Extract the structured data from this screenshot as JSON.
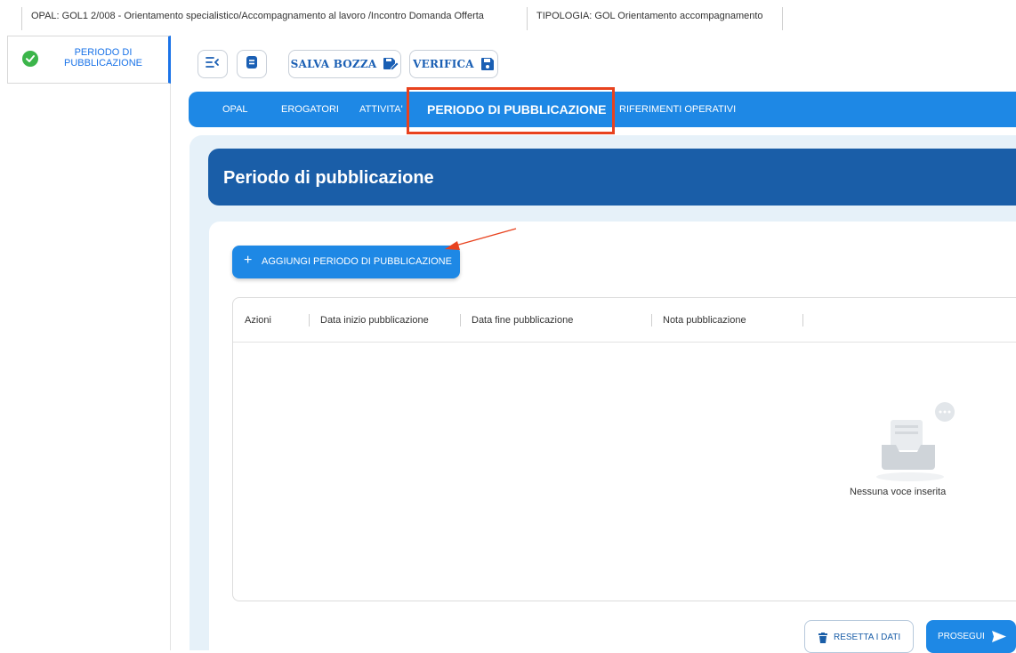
{
  "breadcrumb": {
    "opal": "OPAL: GOL1 2/008 - Orientamento specialistico/Accompagnamento al lavoro /Incontro Domanda Offerta",
    "tipologia": "TIPOLOGIA: GOL Orientamento accompagnamento"
  },
  "sidebar": {
    "items": [
      {
        "label": "PERIODO DI PUBBLICAZIONE",
        "status": "completed",
        "icon": "check-circle-icon"
      }
    ]
  },
  "toolbar": {
    "collapse_icon": "collapse-menu-icon",
    "doc_icon": "document-icon",
    "save_draft_label": "SALVA BOZZA",
    "verify_label": "VERIFICA"
  },
  "tabs": [
    {
      "label": "OPAL",
      "active": false
    },
    {
      "label": "EROGATORI",
      "active": false
    },
    {
      "label": "ATTIVITA'",
      "active": false
    },
    {
      "label": "PERIODO DI PUBBLICAZIONE",
      "active": true
    },
    {
      "label": "RIFERIMENTI OPERATIVI",
      "active": false
    }
  ],
  "section": {
    "title": "Periodo di pubblicazione",
    "add_button_label": "AGGIUNGI PERIODO DI PUBBLICAZIONE"
  },
  "table": {
    "columns": [
      "Azioni",
      "Data inizio pubblicazione",
      "Data fine pubblicazione",
      "Nota pubblicazione"
    ],
    "rows": [],
    "empty_message": "Nessuna voce inserita"
  },
  "footer": {
    "reset_label": "RESETTA I DATI",
    "next_label": "PROSEGUI"
  },
  "colors": {
    "primary": "#1e88e5",
    "header_dark": "#1a5ea8",
    "annotation": "#e8421e",
    "success": "#3bb54a"
  }
}
